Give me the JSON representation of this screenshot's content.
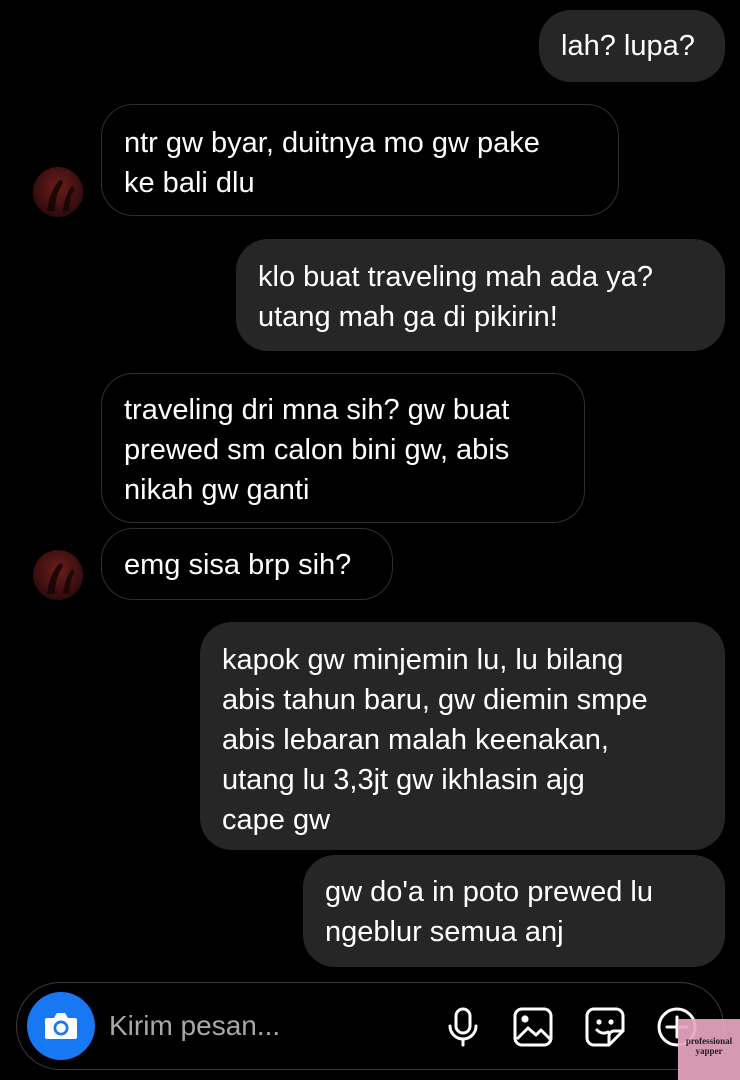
{
  "messages": [
    {
      "from": "me",
      "lines": [
        "lah? lupa?"
      ]
    },
    {
      "from": "them",
      "lines": [
        "ntr gw byar, duitnya mo gw pake",
        "ke bali dlu"
      ]
    },
    {
      "from": "me",
      "lines": [
        "klo buat traveling mah ada ya?",
        "utang mah ga di pikirin!"
      ]
    },
    {
      "from": "them",
      "lines": [
        "traveling dri mna sih? gw buat",
        "prewed sm calon bini gw, abis",
        "nikah gw ganti"
      ]
    },
    {
      "from": "them",
      "lines": [
        "emg sisa brp sih?"
      ]
    },
    {
      "from": "me",
      "lines": [
        "kapok gw minjemin lu, lu bilang",
        "abis tahun baru, gw diemin smpe",
        "abis lebaran malah keenakan,",
        "utang lu 3,3jt gw ikhlasin ajg",
        "cape gw"
      ]
    },
    {
      "from": "me",
      "lines": [
        "gw do'a in poto prewed lu",
        "ngeblur semua anj"
      ]
    }
  ],
  "composer": {
    "placeholder": "Kirim pesan...",
    "value": "",
    "camera_icon": "camera-icon",
    "tools": [
      "microphone-icon",
      "image-icon",
      "sticker-icon",
      "plus-circle-icon"
    ]
  },
  "watermark": {
    "line1": "professional",
    "line2": "yapper"
  },
  "colors": {
    "background": "#000000",
    "sent_bubble": "#262626",
    "received_border": "#2f2f2f",
    "camera_button": "#1877f2",
    "placeholder": "#a8a8a8"
  }
}
